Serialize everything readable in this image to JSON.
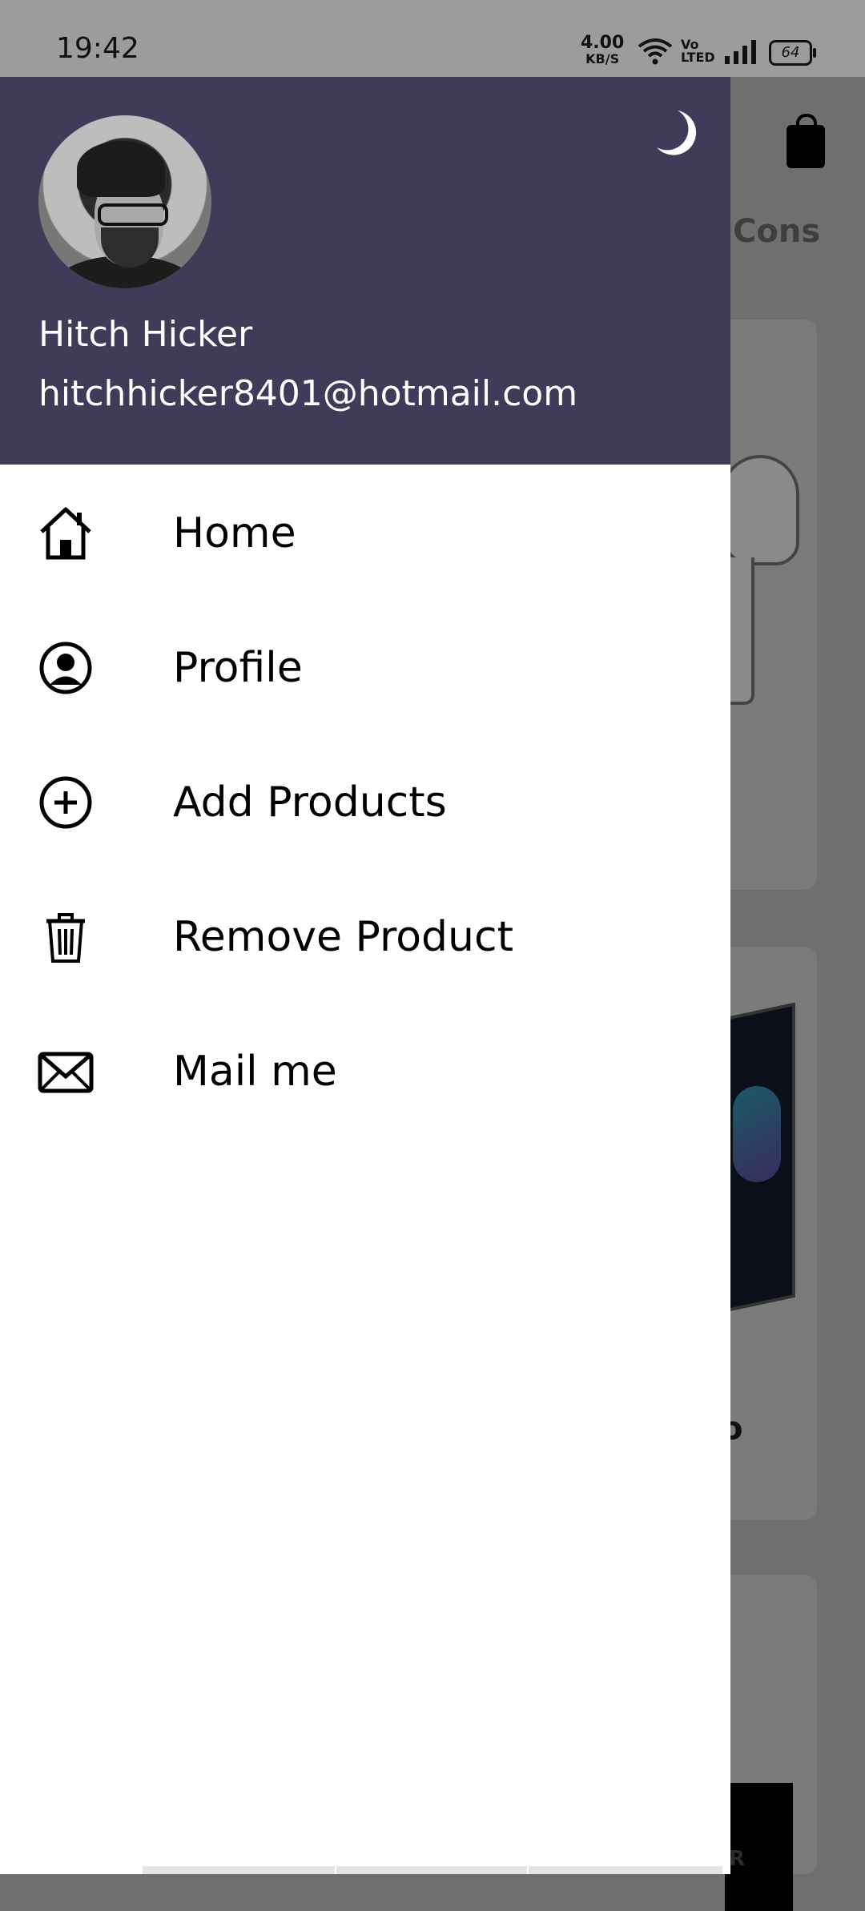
{
  "status_bar": {
    "time": "19:42",
    "net_speed_value": "4.00",
    "net_speed_unit": "KB/S",
    "volte_top": "Vo",
    "volte_bottom": "LTED",
    "battery": "64"
  },
  "background": {
    "tab_text": "Cons",
    "partial_card_text": "o",
    "monitor_label": "R"
  },
  "drawer": {
    "header": {
      "user_name": "Hitch Hicker",
      "user_email": "hitchhicker8401@hotmail.com",
      "header_color": "#413b5a"
    },
    "items": [
      {
        "label": "Home",
        "icon": "home-icon"
      },
      {
        "label": "Profile",
        "icon": "profile-icon"
      },
      {
        "label": "Add Products",
        "icon": "add-circle-icon"
      },
      {
        "label": "Remove Product",
        "icon": "trash-icon"
      },
      {
        "label": "Mail me",
        "icon": "mail-icon"
      }
    ]
  }
}
